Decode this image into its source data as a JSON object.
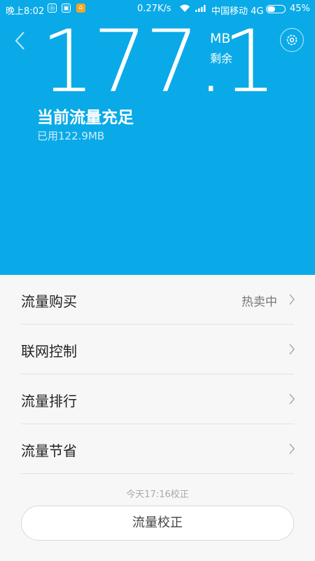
{
  "status_bar": {
    "time": "晚上8:02",
    "speed": "0.27K/s",
    "carrier": "中国移动 4G",
    "battery_percent": "45%",
    "battery_level": 0.45,
    "notification_icons": [
      "weibo-icon",
      "app-icon",
      "mi-icon"
    ]
  },
  "hero": {
    "remaining_value": "177.1",
    "remaining_unit": "MB",
    "remaining_label": "剩余",
    "status_title": "当前流量充足",
    "used_text": "已用122.9MB",
    "background_color": "#0aaae8"
  },
  "menu": {
    "items": [
      {
        "label": "流量购买",
        "badge": "热卖中"
      },
      {
        "label": "联网控制",
        "badge": ""
      },
      {
        "label": "流量排行",
        "badge": ""
      },
      {
        "label": "流量节省",
        "badge": ""
      }
    ]
  },
  "calibration": {
    "note": "今天17:16校正",
    "button_label": "流量校正"
  }
}
